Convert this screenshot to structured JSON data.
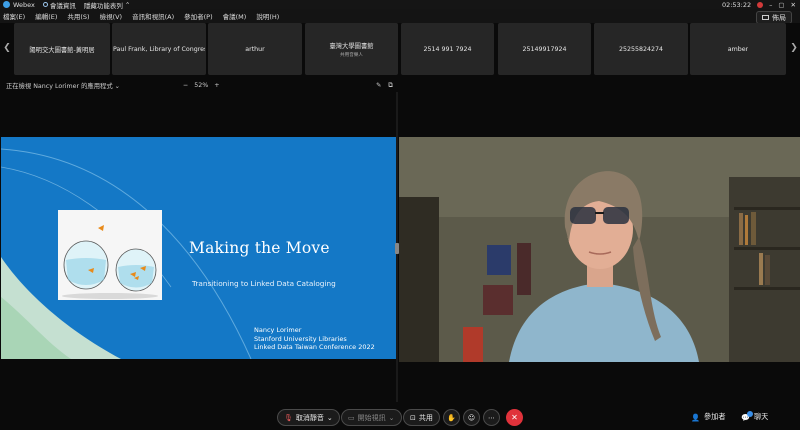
{
  "titlebar": {
    "app_name": "Webex",
    "meeting_info": "會議資訊",
    "hide_menu": "隱藏功能表列",
    "time": "02:53:22"
  },
  "menu": {
    "items": [
      "檔案(E)",
      "編輯(E)",
      "共用(S)",
      "檢視(V)",
      "音訊和視訊(A)",
      "參加者(P)",
      "會議(M)",
      "說明(H)"
    ],
    "layout_label": "佈局"
  },
  "participants": [
    {
      "name": "陽明交大圖書館-黃明居",
      "sub": ""
    },
    {
      "name": "Paul Frank, Library of Congres...",
      "sub": ""
    },
    {
      "name": "arthur",
      "sub": ""
    },
    {
      "name": "臺灣大學圖書館",
      "sub": "共用音樂人"
    },
    {
      "name": "2514 991 7924",
      "sub": ""
    },
    {
      "name": "25149917924",
      "sub": ""
    },
    {
      "name": "25255824274",
      "sub": ""
    },
    {
      "name": "amber",
      "sub": ""
    }
  ],
  "share": {
    "label": "正在檢視 Nancy Lorimer 的應用程式",
    "zoom": "52%"
  },
  "slide": {
    "title": "Making the Move",
    "subtitle": "Transitioning to Linked Data Cataloging",
    "credits": [
      "Nancy Lorimer",
      "Stanford University Libraries",
      "Linked Data Taiwan Conference 2022"
    ]
  },
  "controls": {
    "mute": "取消靜音",
    "video": "開始視訊",
    "share": "共用",
    "participants": "參加者",
    "chat": "聊天"
  },
  "colors": {
    "slide_blue": "#1478c6",
    "end_red": "#e0323b",
    "accent": "#3ea0e8"
  }
}
